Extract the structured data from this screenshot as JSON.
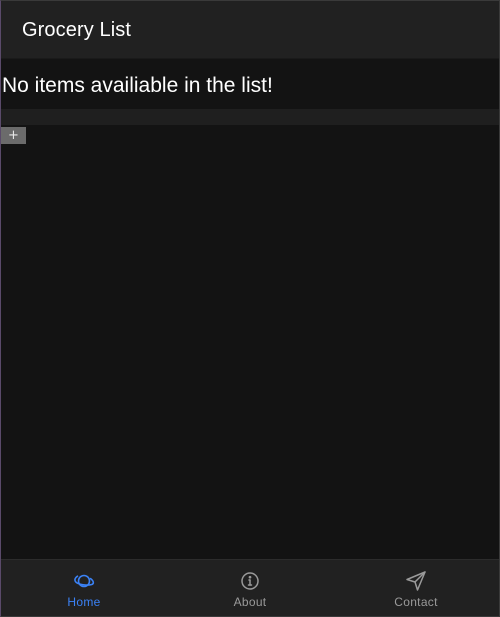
{
  "header": {
    "title": "Grocery List"
  },
  "main": {
    "empty_message": "No items availiable in the list!",
    "add_button_label": "+"
  },
  "tabbar": {
    "tabs": [
      {
        "label": "Home",
        "icon": "planet-icon",
        "active": true
      },
      {
        "label": "About",
        "icon": "info-icon",
        "active": false
      },
      {
        "label": "Contact",
        "icon": "send-icon",
        "active": false
      }
    ]
  },
  "colors": {
    "background": "#131313",
    "bar": "#212121",
    "accent": "#3b82f6",
    "inactive": "#9a9a9a",
    "add_button": "#6b6b6b"
  }
}
